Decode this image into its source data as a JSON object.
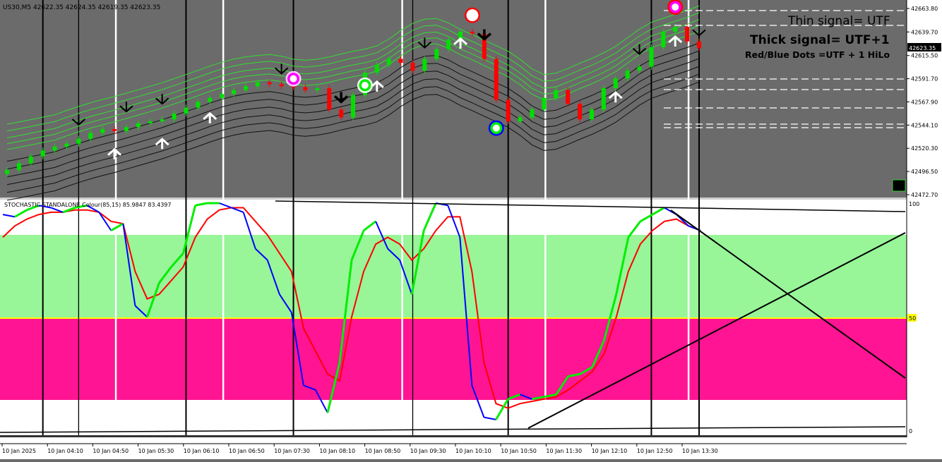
{
  "window": {
    "symbol_info": "US30,M5  42622.35 42624.35 42619.35 42623.35"
  },
  "annotations": {
    "thin_signal": "Thin signal= UTF",
    "thick_signal": "Thick signal= UTF+1",
    "dots_legend": "Red/Blue Dots =UTF + 1 HiLo"
  },
  "indicator": {
    "title": "STOCHASTIC STANDALONE Colour(85,15) 85.9847 83.4397",
    "level_50_label": "50",
    "level_100_label": "100",
    "level_0_label": "0"
  },
  "price_axis": {
    "ticks": [
      "42663.80",
      "42639.70",
      "42615.50",
      "42591.70",
      "42567.90",
      "42544.10",
      "42520.30",
      "42496.50",
      "42472.70"
    ],
    "current_price": "42623.35"
  },
  "time_axis": {
    "ticks": [
      "10 Jan 2025",
      "10 Jan 04:10",
      "10 Jan 04:50",
      "10 Jan 05:30",
      "10 Jan 06:10",
      "10 Jan 06:50",
      "10 Jan 07:30",
      "10 Jan 08:10",
      "10 Jan 08:50",
      "10 Jan 09:30",
      "10 Jan 10:10",
      "10 Jan 10:50",
      "10 Jan 11:30",
      "10 Jan 12:10",
      "10 Jan 12:50",
      "10 Jan 13:30"
    ]
  },
  "colors": {
    "background": "#6b6b6b",
    "bull": "#00e000",
    "bear": "#ff0000",
    "ma_upper": "#33dd33",
    "ma_lower": "#111111",
    "zone_overbought": "#ffffff",
    "zone_upper": "#98f598",
    "zone_lower": "#ff1493",
    "level_50": "#ffff00",
    "stoch_main": "#00ee00",
    "stoch_signal": "#ff0000",
    "stoch_bear": "#0000ff"
  },
  "chart_data": [
    {
      "type": "candlestick",
      "title": "US30,M5",
      "x": [
        "04:00",
        "04:10",
        "04:20",
        "04:30",
        "04:40",
        "04:50",
        "05:00",
        "05:10",
        "05:20",
        "05:30",
        "05:40",
        "05:50",
        "06:00",
        "06:10",
        "06:20",
        "06:30",
        "06:40",
        "06:50",
        "07:00",
        "07:10",
        "07:20",
        "07:30",
        "07:40",
        "07:50",
        "08:00",
        "08:10",
        "08:20",
        "08:30",
        "08:40",
        "08:50",
        "09:00",
        "09:10",
        "09:20",
        "09:30",
        "09:40",
        "09:50",
        "10:00",
        "10:10",
        "10:20",
        "10:30",
        "10:40",
        "10:50",
        "11:00",
        "11:10",
        "11:20",
        "11:30",
        "11:40",
        "11:50",
        "12:00",
        "12:10",
        "12:20",
        "12:30",
        "12:40",
        "12:50",
        "13:00",
        "13:10",
        "13:20",
        "13:30",
        "13:40"
      ],
      "close": [
        42498,
        42505,
        42512,
        42518,
        42522,
        42525,
        42530,
        42536,
        42540,
        42538,
        42542,
        42546,
        42548,
        42550,
        42556,
        42562,
        42568,
        42572,
        42576,
        42580,
        42584,
        42588,
        42586,
        42584,
        42583,
        42580,
        42582,
        42560,
        42552,
        42575,
        42598,
        42606,
        42612,
        42608,
        42600,
        42612,
        42622,
        42632,
        42640,
        42638,
        42612,
        42570,
        42548,
        42552,
        42560,
        42572,
        42580,
        42566,
        42550,
        42560,
        42582,
        42592,
        42600,
        42604,
        42624,
        42640,
        42645,
        42630,
        42623
      ],
      "ylim": [
        42472.7,
        42663.8
      ]
    },
    {
      "type": "line",
      "title": "STOCHASTIC STANDALONE Colour(85,15) 85.9847 83.4397",
      "x": [
        "04:00",
        "04:10",
        "04:20",
        "04:30",
        "04:40",
        "04:50",
        "05:00",
        "05:10",
        "05:20",
        "05:30",
        "05:40",
        "05:50",
        "06:00",
        "06:10",
        "06:20",
        "06:30",
        "06:40",
        "06:50",
        "07:00",
        "07:10",
        "07:20",
        "07:30",
        "07:40",
        "07:50",
        "08:00",
        "08:10",
        "08:20",
        "08:30",
        "08:40",
        "08:50",
        "09:00",
        "09:10",
        "09:20",
        "09:30",
        "09:40",
        "09:50",
        "10:00",
        "10:10",
        "10:20",
        "10:30",
        "10:40",
        "10:50",
        "11:00",
        "11:10",
        "11:20",
        "11:30",
        "11:40",
        "11:50",
        "12:00",
        "12:10",
        "12:20",
        "12:30",
        "12:40",
        "12:50",
        "13:00",
        "13:10",
        "13:20",
        "13:30",
        "13:40"
      ],
      "series": [
        {
          "values": [
            95,
            94,
            97,
            99,
            98,
            96,
            98,
            99,
            96,
            88,
            91,
            55,
            50,
            65,
            72,
            78,
            99,
            100,
            100,
            98,
            96,
            80,
            75,
            60,
            52,
            20,
            18,
            8,
            30,
            75,
            88,
            92,
            80,
            75,
            60,
            88,
            100,
            99,
            85,
            20,
            6,
            5,
            14,
            16,
            14,
            15,
            16,
            24,
            25,
            28,
            40,
            60,
            85,
            92,
            95,
            98,
            95,
            90,
            88
          ]
        },
        {
          "values": [
            85,
            90,
            93,
            95,
            96,
            96,
            97,
            97,
            96,
            92,
            91,
            70,
            58,
            60,
            66,
            72,
            85,
            93,
            97,
            98,
            98,
            92,
            86,
            78,
            70,
            45,
            35,
            25,
            22,
            50,
            70,
            82,
            85,
            82,
            75,
            80,
            88,
            94,
            94,
            70,
            30,
            12,
            10,
            12,
            13,
            14,
            15,
            18,
            22,
            26,
            34,
            50,
            70,
            82,
            88,
            92,
            93,
            90,
            88
          ]
        }
      ],
      "ylim": [
        0,
        100
      ],
      "levels": [
        0,
        15,
        50,
        85,
        100
      ]
    }
  ]
}
